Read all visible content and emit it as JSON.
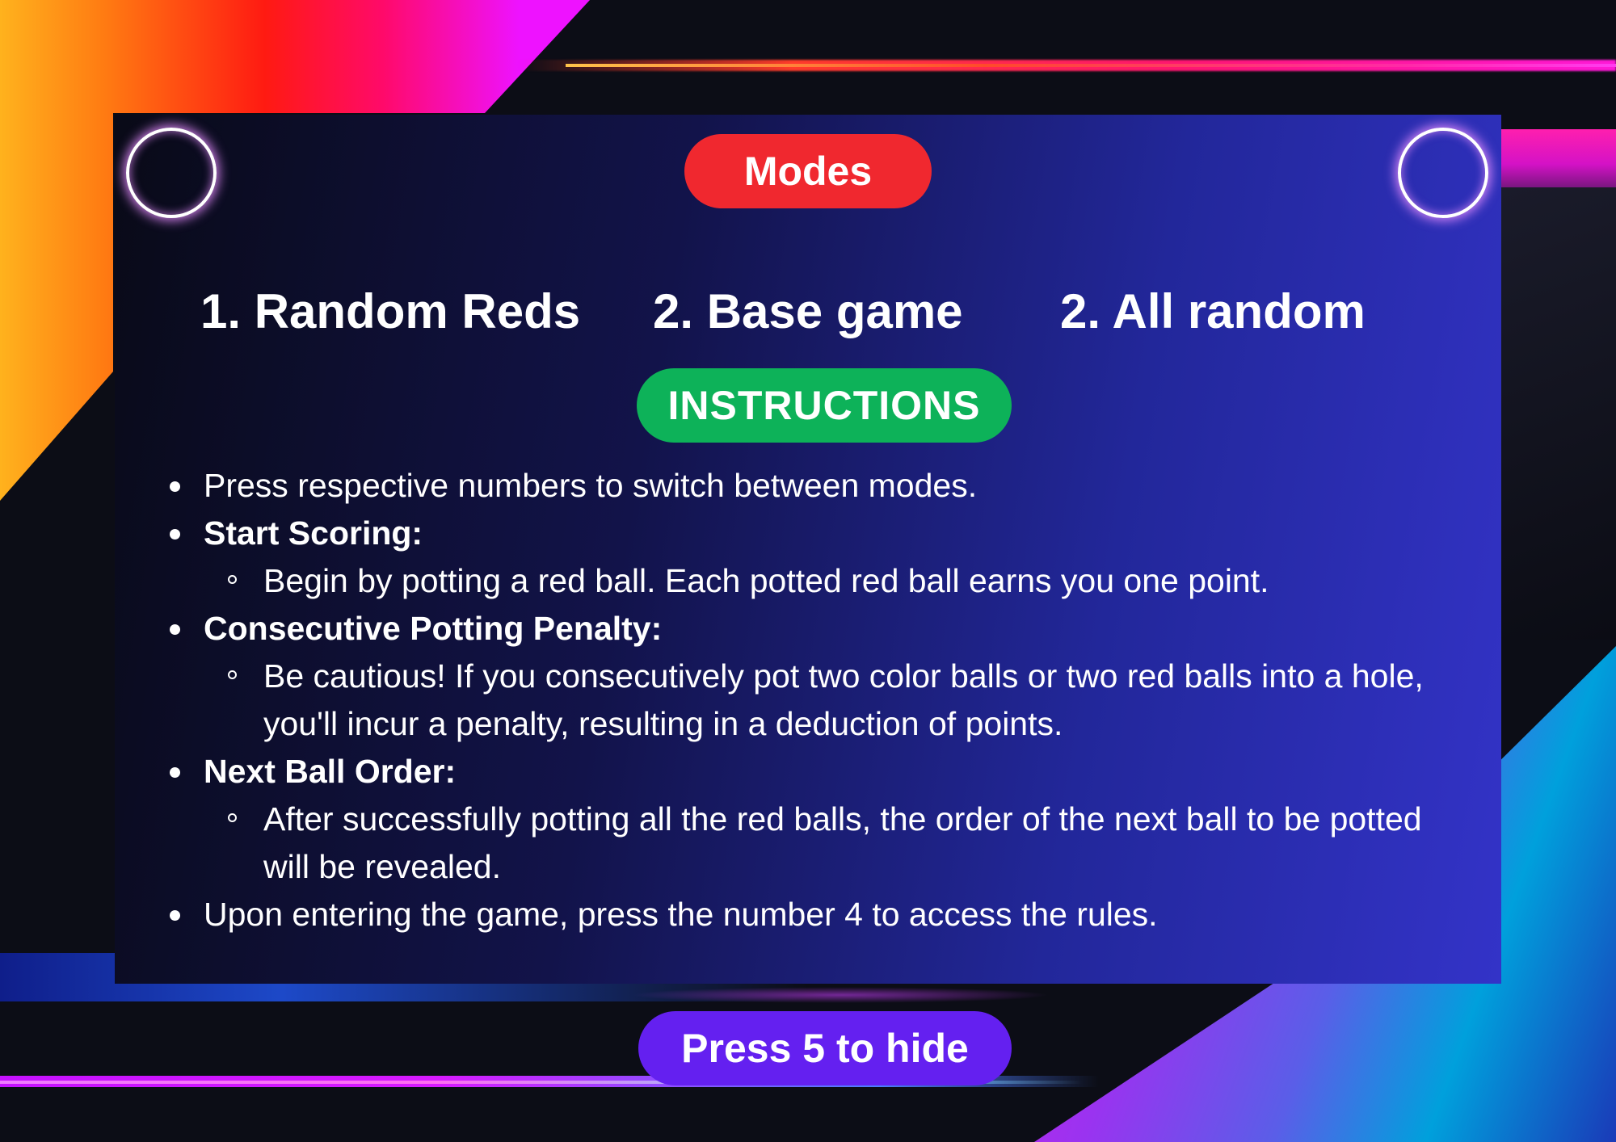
{
  "header": {
    "modes_label": "Modes"
  },
  "modes": [
    {
      "label": "1. Random Reds"
    },
    {
      "label": "2. Base game"
    },
    {
      "label": "2. All random"
    }
  ],
  "instructions": {
    "label": "INSTRUCTIONS",
    "items": [
      {
        "text": "Press respective numbers to switch between modes."
      },
      {
        "text": "Start Scoring:",
        "bold": true
      },
      {
        "text": "Begin by potting a red ball. Each potted red ball earns you one point.",
        "sub": true
      },
      {
        "text": "Consecutive Potting Penalty:",
        "bold": true
      },
      {
        "text": "Be cautious! If you consecutively pot two color balls or two red balls into a hole, you'll incur a penalty, resulting in a deduction of points.",
        "sub": true
      },
      {
        "text": "Next Ball Order:",
        "bold": true
      },
      {
        "text": "After successfully potting all the red balls, the order of the next ball to be potted will be revealed.",
        "sub": true
      },
      {
        "text": "Upon entering the game, press the number 4 to access the rules."
      }
    ]
  },
  "footer": {
    "hide_label": "Press 5 to hide"
  },
  "colors": {
    "modes_pill": "#f0282f",
    "instructions_pill": "#0db259",
    "hide_pill": "#6420f0"
  }
}
